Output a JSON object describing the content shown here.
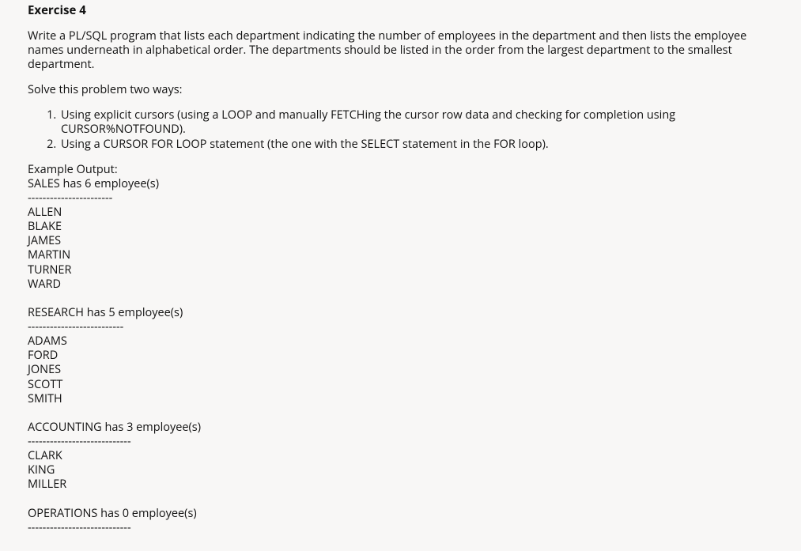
{
  "title": "Exercise 4",
  "intro": "Write a PL/SQL program that lists each department indicating the number of employees in the department and then lists the employee names underneath in alphabetical order. The departments should be listed in the order from the largest department to the smallest department.",
  "solve_line": "Solve this problem two ways:",
  "ways": [
    "Using explicit cursors (using a LOOP and manually FETCHing the cursor row data and checking for completion using CURSOR%NOTFOUND).",
    "Using a CURSOR FOR LOOP statement (the one with the SELECT statement in the FOR loop)."
  ],
  "example_label": "Example Output:",
  "departments": [
    {
      "header": "SALES has 6 employee(s)",
      "divider": "-----------------------",
      "employees": [
        "ALLEN",
        "BLAKE",
        "JAMES",
        "MARTIN",
        "TURNER",
        "WARD"
      ]
    },
    {
      "header": "RESEARCH has 5 employee(s)",
      "divider": "--------------------------",
      "employees": [
        "ADAMS",
        "FORD",
        "JONES",
        "SCOTT",
        "SMITH"
      ]
    },
    {
      "header": "ACCOUNTING has 3 employee(s)",
      "divider": "----------------------------",
      "employees": [
        "CLARK",
        "KING",
        "MILLER"
      ]
    },
    {
      "header": "OPERATIONS has 0 employee(s)",
      "divider": "----------------------------",
      "employees": []
    }
  ]
}
